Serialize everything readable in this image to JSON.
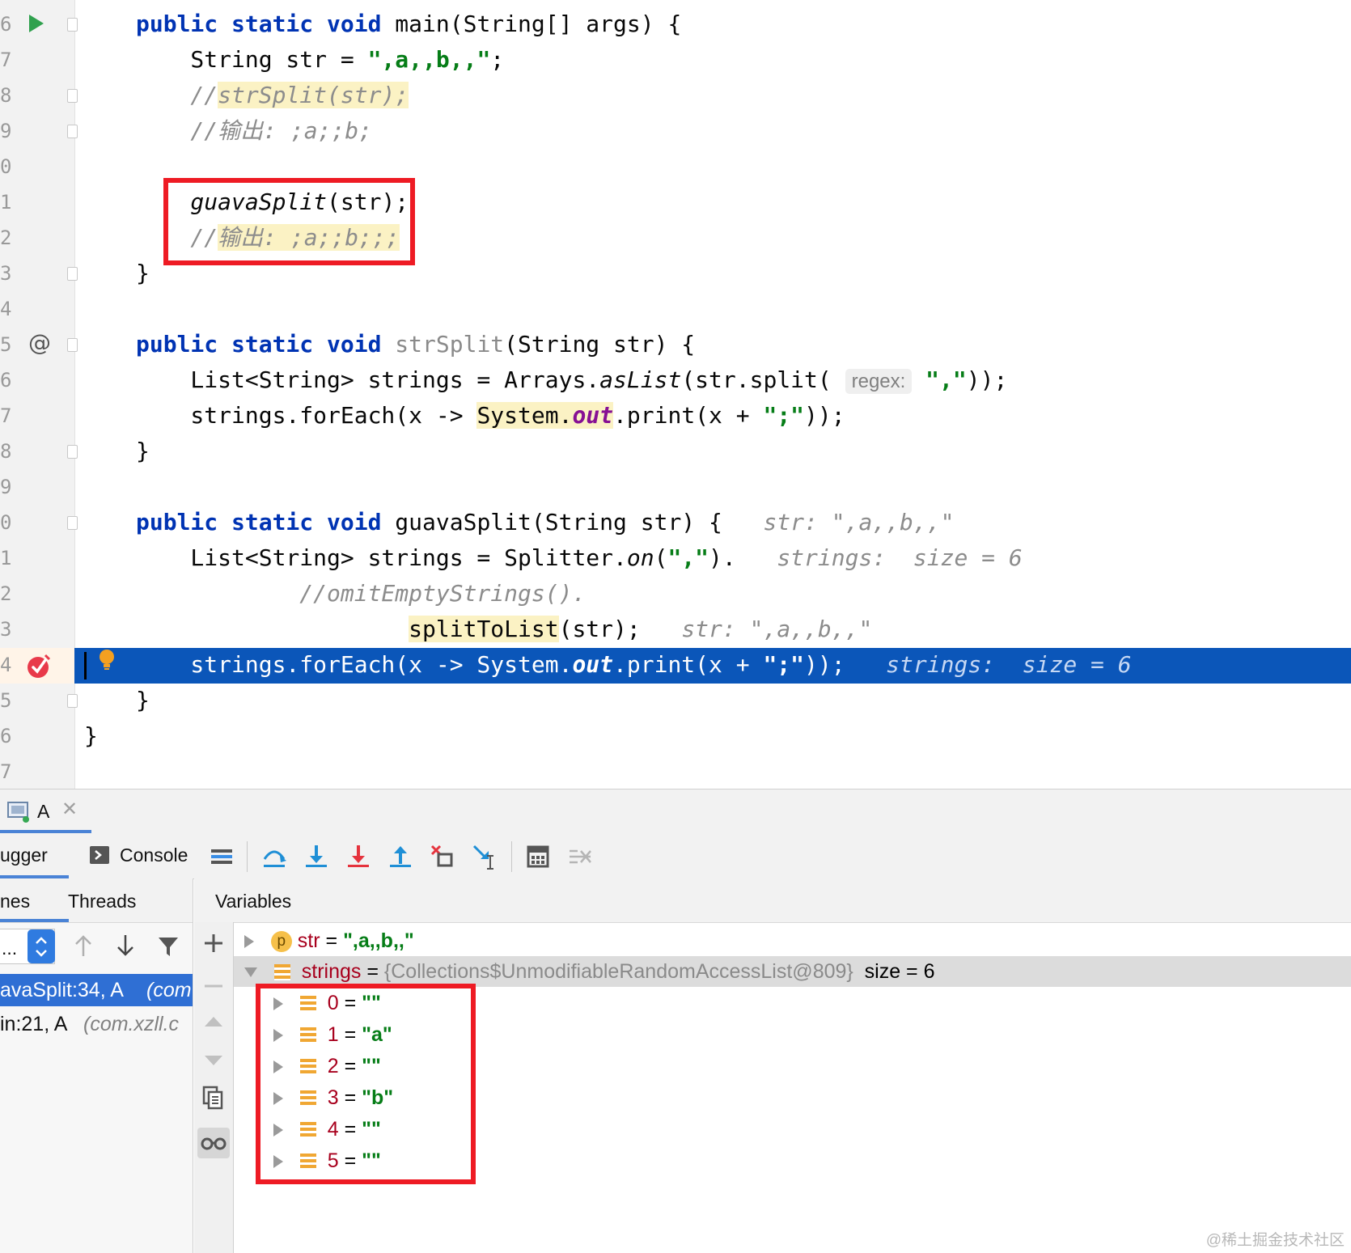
{
  "editor": {
    "line_numbers": [
      "6",
      "7",
      "8",
      "9",
      "0",
      "1",
      "2",
      "3",
      "4",
      "5",
      "6",
      "7",
      "8",
      "9",
      "0",
      "1",
      "2",
      "3",
      "4",
      "5",
      "6",
      "7"
    ],
    "lines": {
      "l1": {
        "kw": "public static void",
        "rest": " main(String[] args) {"
      },
      "l2": {
        "a": "    String str = ",
        "s": "\",a,,b,,\"",
        "b": ";"
      },
      "l3": {
        "c1": "    //",
        "c2": "strSplit(str);"
      },
      "l4": {
        "c": "    //输出: ;a;;b;"
      },
      "l6": {
        "f": "    guavaSplit",
        "r": "(str);"
      },
      "l7": {
        "c1": "    //",
        "c2": "输出: ;a;;b;;;"
      },
      "l8": {
        "t": "}"
      },
      "l10": {
        "kw": "public static void",
        "name": " strSplit",
        "rest": "(String str) {"
      },
      "l11": {
        "a": "    List<String> strings = Arrays.",
        "m": "asList",
        "b": "(str.split( ",
        "hint": "regex:",
        "s": "\",\"",
        "c": "));"
      },
      "l12": {
        "a": "    strings.forEach(x -> ",
        "sys": "System.",
        "out": "out",
        "b": ".print(x + ",
        "s": "\";\"",
        "c": "));"
      },
      "l13": {
        "t": "}"
      },
      "l15": {
        "kw": "public static void",
        "rest": " guavaSplit(String str) {",
        "inl": "   str: \",a,,b,,\""
      },
      "l16": {
        "a": "    List<String> strings = Splitter.",
        "m": "on",
        "b": "(",
        "s": "\",\"",
        "c": ").",
        "inl": "   strings:  size = 6"
      },
      "l17": {
        "c": "            //omitEmptyStrings()."
      },
      "l18": {
        "pad": "                    ",
        "m": "splitToList",
        "b": "(str);",
        "inl": "   str: \",a,,b,,\""
      },
      "l19": {
        "a": "    strings.forEach(x -> System.",
        "out": "out",
        "b": ".print(x + ",
        "s": "\";\"",
        "c": "));",
        "inl": "   strings:  size = 6"
      },
      "l20": {
        "t": "}"
      },
      "l21": {
        "t": "}"
      }
    }
  },
  "panel": {
    "run_tab_label": "A",
    "debugger_tab_label": "ugger",
    "console_tab_label": "Console",
    "frames_tab_label": "nes",
    "threads_tab_label": "Threads",
    "variables_header": "Variables",
    "thread_selector": "...",
    "frames": [
      {
        "method": "avaSplit:34, A ",
        "pkg": "(com"
      },
      {
        "method": "in:21, A ",
        "pkg": "(com.xzll.c"
      }
    ],
    "variables": {
      "str": {
        "badge": "p",
        "name": "str",
        "eq": " = ",
        "value": "\",a,,b,,\""
      },
      "strings": {
        "name": "strings",
        "eq": " = ",
        "obj": "{Collections$UnmodifiableRandomAccessList@809}",
        "size": "  size = 6"
      },
      "items": [
        {
          "index": "0",
          "eq": " = ",
          "value": "\"\""
        },
        {
          "index": "1",
          "eq": " = ",
          "value": "\"a\""
        },
        {
          "index": "2",
          "eq": " = ",
          "value": "\"\""
        },
        {
          "index": "3",
          "eq": " = ",
          "value": "\"b\""
        },
        {
          "index": "4",
          "eq": " = ",
          "value": "\"\""
        },
        {
          "index": "5",
          "eq": " = ",
          "value": "\"\""
        }
      ]
    },
    "watermark": "@稀土掘金技术社区"
  },
  "colors": {
    "keyword": "#0033b3",
    "string": "#067d17",
    "current_line": "#0b56b9",
    "highlight_box": "#ee1b24",
    "var_name": "#a8001d"
  }
}
